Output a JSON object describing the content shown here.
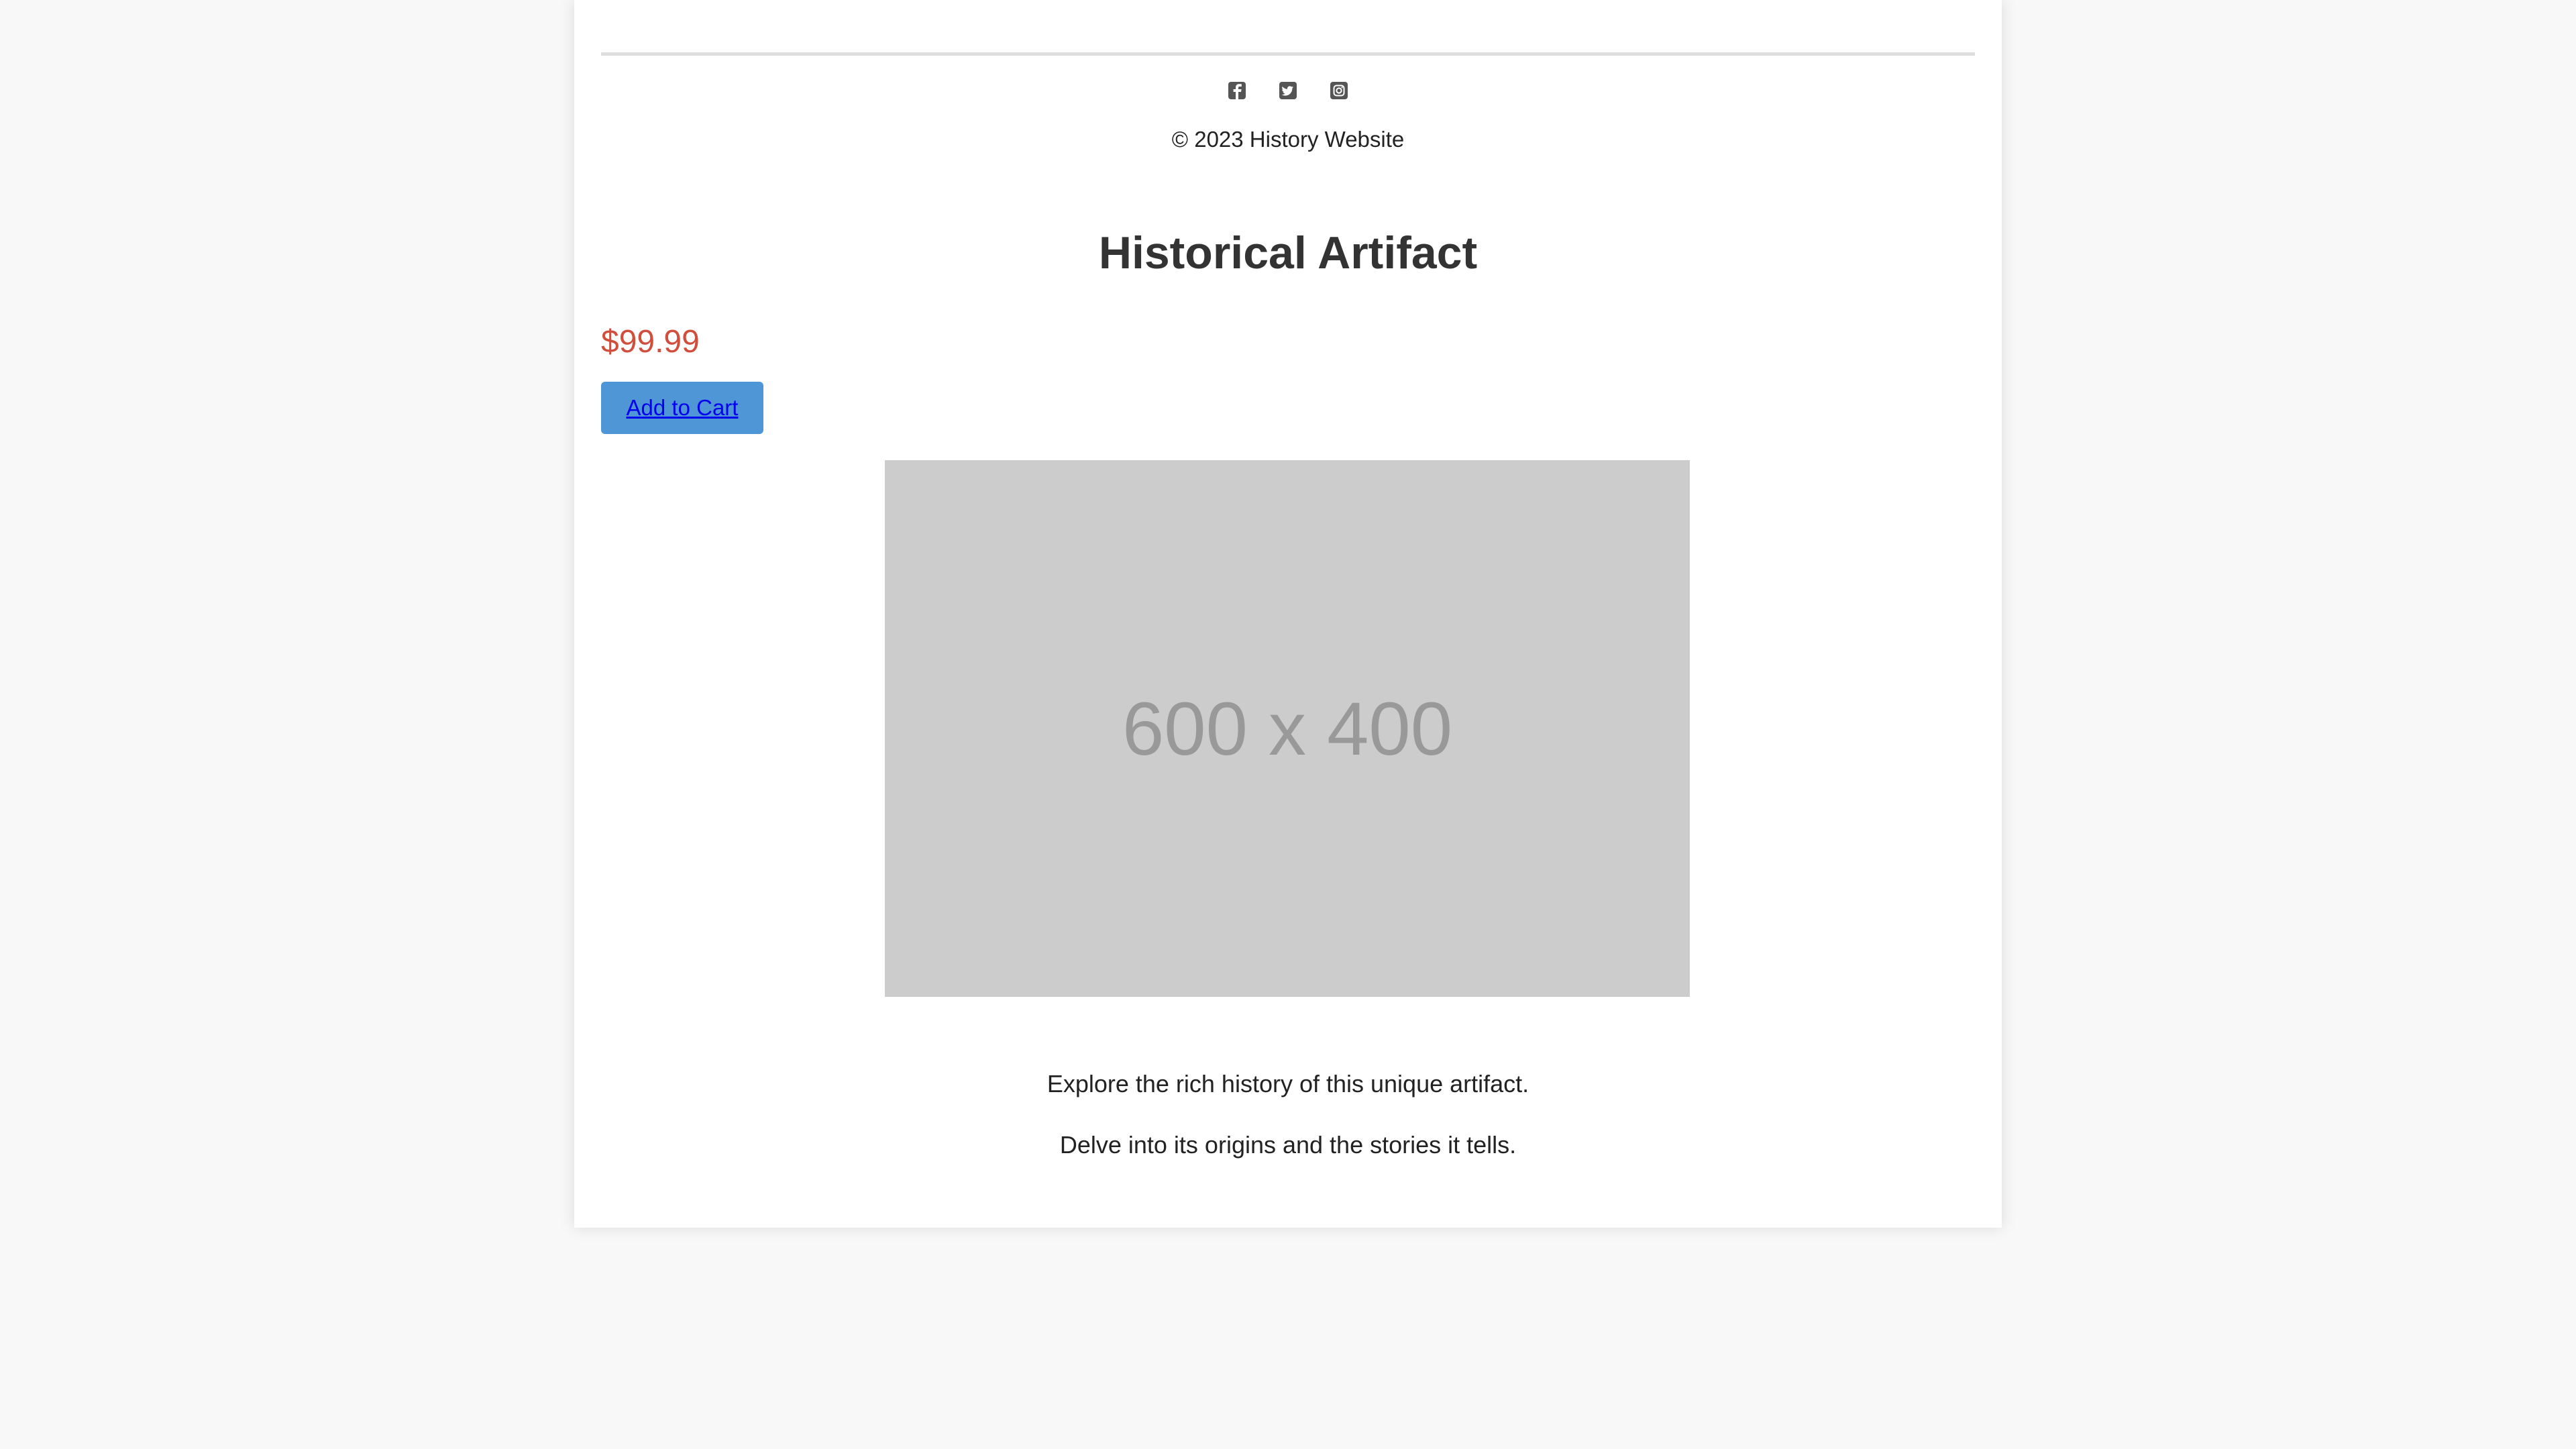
{
  "footer": {
    "social_icons": [
      "facebook-icon",
      "twitter-icon",
      "instagram-icon"
    ],
    "copyright": "© 2023 History Website"
  },
  "product": {
    "title": "Historical Artifact",
    "price": "$99.99",
    "add_to_cart_label": "Add to Cart",
    "image_placeholder": "600 x 400",
    "description": [
      "Explore the rich history of this unique artifact.",
      "Delve into its origins and the stories it tells."
    ]
  },
  "colors": {
    "price": "#d24e3c",
    "button": "#4f96d6",
    "link": "#0000ee",
    "placeholder_bg": "#cccccc",
    "placeholder_text": "#999999"
  }
}
